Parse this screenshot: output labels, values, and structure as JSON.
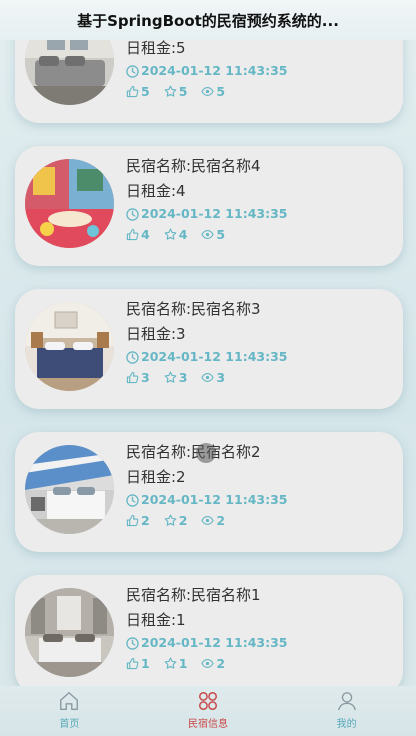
{
  "header": {
    "title": "基于SpringBoot的民宿预约系统的..."
  },
  "items": [
    {
      "name": "",
      "rent": "日租金:5",
      "time": "2024-01-12 11:43:35",
      "likes": "5",
      "favorites": "5",
      "views": "5"
    },
    {
      "name": "民宿名称:民宿名称4",
      "rent": "日租金:4",
      "time": "2024-01-12 11:43:35",
      "likes": "4",
      "favorites": "4",
      "views": "5"
    },
    {
      "name": "民宿名称:民宿名称3",
      "rent": "日租金:3",
      "time": "2024-01-12 11:43:35",
      "likes": "3",
      "favorites": "3",
      "views": "3"
    },
    {
      "name": "民宿名称:民宿名称2",
      "rent": "日租金:2",
      "time": "2024-01-12 11:43:35",
      "likes": "2",
      "favorites": "2",
      "views": "2"
    },
    {
      "name": "民宿名称:民宿名称1",
      "rent": "日租金:1",
      "time": "2024-01-12 11:43:35",
      "likes": "1",
      "favorites": "1",
      "views": "2"
    }
  ],
  "tabbar": {
    "tabs": [
      {
        "label": "首页",
        "icon": "home-icon"
      },
      {
        "label": "民宿信息",
        "icon": "homestay-icon",
        "active": true
      },
      {
        "label": "我的",
        "icon": "user-icon"
      }
    ]
  },
  "colors": {
    "accent": "#66b7c5",
    "active_tab": "#c84848",
    "card_bg": "#ececec"
  }
}
